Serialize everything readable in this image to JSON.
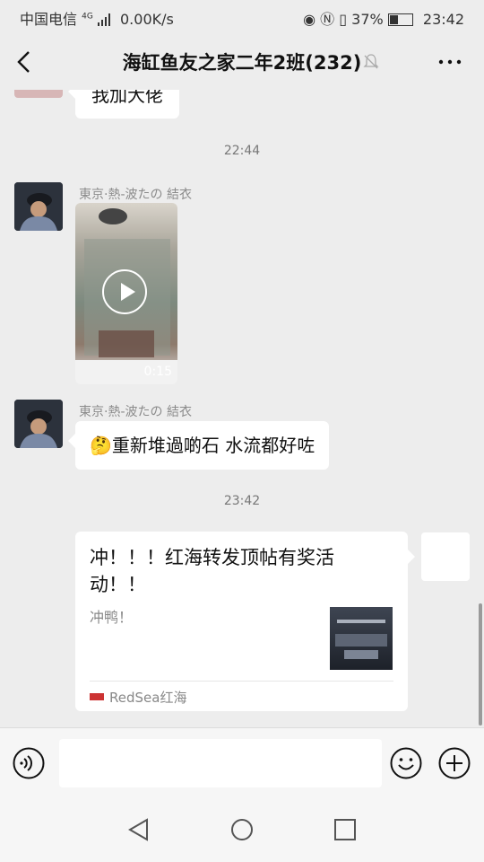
{
  "status_bar": {
    "carrier": "中国电信",
    "net_type": "4G",
    "speed": "0.00K/s",
    "battery": "37%",
    "time": "23:42"
  },
  "header": {
    "title": "海缸鱼友之家二年2班(232)"
  },
  "messages": [
    {
      "type": "text",
      "partial": true,
      "text": "我加大佬"
    },
    {
      "type": "time",
      "text": "22:44"
    },
    {
      "type": "video",
      "sender": "東京·熱-波たの 結衣",
      "duration": "0:15"
    },
    {
      "type": "text",
      "sender": "東京·熱-波たの 結衣",
      "emoji": "🤔",
      "text": "重新堆過啲石 水流都好咗"
    },
    {
      "type": "time",
      "text": "23:42"
    },
    {
      "type": "link",
      "title": "冲！！！红海转发顶帖有奖活动！！",
      "desc": "冲鸭！",
      "source": "RedSea红海"
    }
  ],
  "input_bar": {
    "value": ""
  }
}
